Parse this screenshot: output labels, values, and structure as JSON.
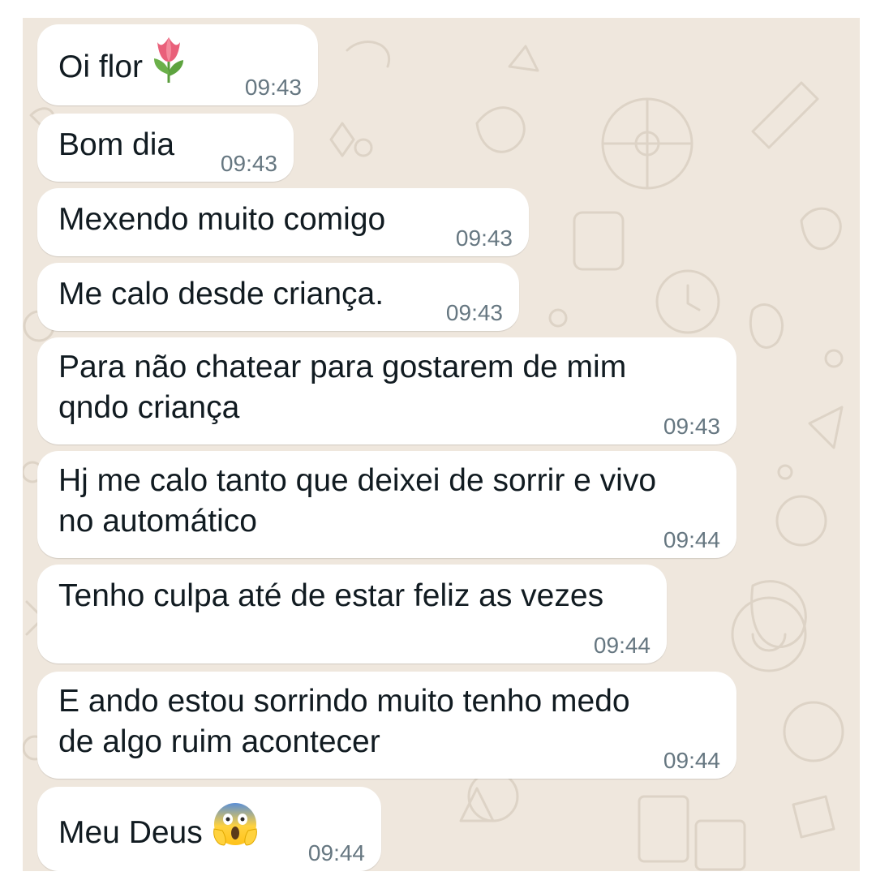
{
  "chat": {
    "background_color": "#efe7dd",
    "bubble_color": "#ffffff",
    "text_color": "#111b21",
    "time_color": "#667781",
    "messages": [
      {
        "lines": [
          "Oi flor"
        ],
        "time": "09:43",
        "emoji": "tulip-icon"
      },
      {
        "lines": [
          "Bom dia"
        ],
        "time": "09:43"
      },
      {
        "lines": [
          "Mexendo muito comigo"
        ],
        "time": "09:43"
      },
      {
        "lines": [
          "Me calo desde criança."
        ],
        "time": "09:43"
      },
      {
        "lines": [
          "Para não chatear para gostarem de mim",
          "qndo criança"
        ],
        "time": "09:43"
      },
      {
        "lines": [
          "Hj me calo tanto que deixei de sorrir e vivo",
          "no automático"
        ],
        "time": "09:44"
      },
      {
        "lines": [
          "Tenho culpa até de estar feliz as vezes"
        ],
        "time": "09:44"
      },
      {
        "lines": [
          "E ando estou sorrindo muito tenho medo",
          "de algo ruim acontecer"
        ],
        "time": "09:44"
      },
      {
        "lines": [
          "Meu Deus"
        ],
        "time": "09:44",
        "emoji": "screaming-face-icon"
      }
    ]
  }
}
